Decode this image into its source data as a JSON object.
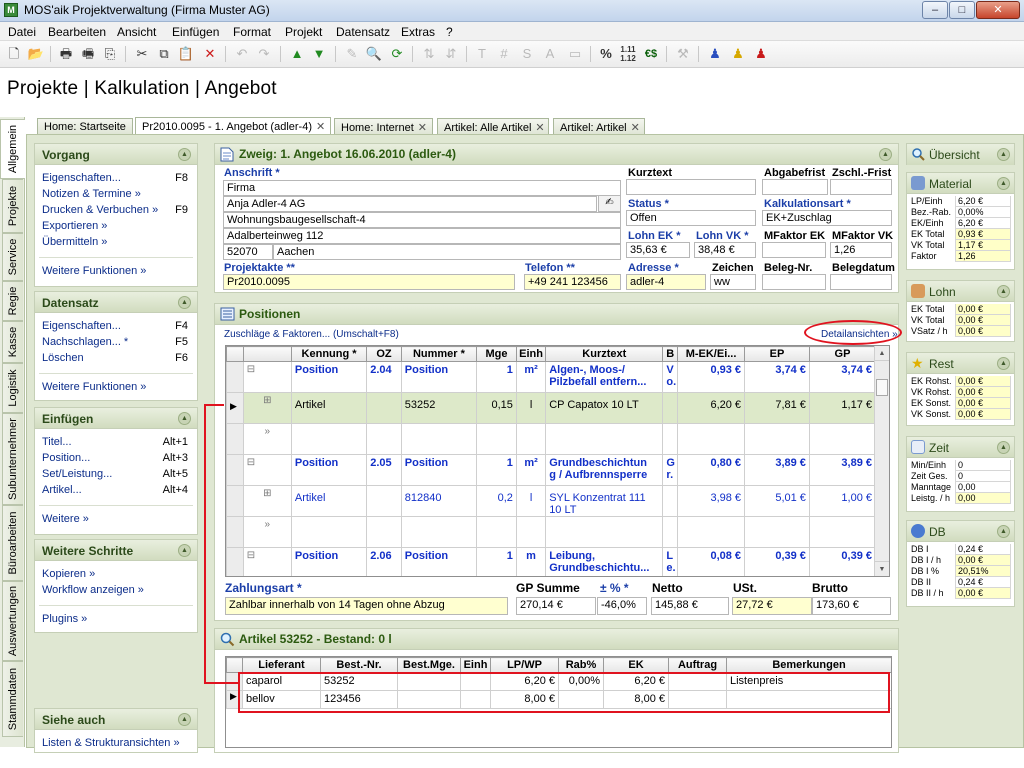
{
  "window": {
    "title": "MOS'aik Projektverwaltung (Firma Muster AG)",
    "minimize": "–",
    "maximize": "□",
    "close": "✕"
  },
  "menu": [
    "Datei",
    "Bearbeiten",
    "Ansicht",
    "Einfügen",
    "Format",
    "Projekt",
    "Datensatz",
    "Extras",
    "?"
  ],
  "toolbar": {
    "numbers_icon_text": "1.11 1.12",
    "euro_icon_text": "€$",
    "pct_icon_text": "%",
    "hash_icon_text": "#",
    "t_icon_text": "T",
    "s_icon_text": "S",
    "a_icon_text": "A"
  },
  "app_title": "Projekte | Kalkulation | Angebot",
  "side_tabs": [
    "Allgemein",
    "Projekte",
    "Service",
    "Regie",
    "Kasse",
    "Logistik",
    "Subunternehmer",
    "Büroarbeiten",
    "Auswertungen",
    "Stammdaten"
  ],
  "doc_tabs": [
    "Home: Startseite",
    "Pr2010.0095 - 1. Angebot (adler-4)",
    "Home: Internet",
    "Artikel: Alle Artikel",
    "Artikel: Artikel"
  ],
  "left_panels": {
    "vorgang": {
      "title": "Vorgang",
      "items": [
        {
          "label": "Eigenschaften...",
          "key": "F8"
        },
        {
          "label": "Notizen & Termine »",
          "key": ""
        },
        {
          "label": "Drucken & Verbuchen »",
          "key": "F9"
        },
        {
          "label": "Exportieren »",
          "key": ""
        },
        {
          "label": "Übermitteln »",
          "key": ""
        }
      ],
      "more": "Weitere Funktionen »"
    },
    "datensatz": {
      "title": "Datensatz",
      "items": [
        {
          "label": "Eigenschaften...",
          "key": "F4"
        },
        {
          "label": "Nachschlagen... *",
          "key": "F5"
        },
        {
          "label": "Löschen",
          "key": "F6"
        }
      ],
      "more": "Weitere Funktionen »"
    },
    "einfuegen": {
      "title": "Einfügen",
      "items": [
        {
          "label": "Titel...",
          "key": "Alt+1"
        },
        {
          "label": "Position...",
          "key": "Alt+3"
        },
        {
          "label": "Set/Leistung...",
          "key": "Alt+5"
        },
        {
          "label": "Artikel...",
          "key": "Alt+4"
        }
      ],
      "more": "Weitere »"
    },
    "weitere_schritte": {
      "title": "Weitere Schritte",
      "items": [
        {
          "label": "Kopieren »"
        },
        {
          "label": "Workflow anzeigen »"
        }
      ],
      "more": "Plugins »"
    },
    "siehe_auch": {
      "title": "Siehe auch",
      "items": [
        {
          "label": "Listen & Strukturansichten »"
        }
      ]
    }
  },
  "zweig": {
    "title": "Zweig: 1. Angebot 16.06.2010 (adler-4)",
    "anschrift_label": "Anschrift *",
    "address": {
      "line1": "Firma",
      "line2": "Anja Adler-4 AG",
      "line3": "Wohnungsbaugesellschaft-4",
      "line4": "Adalberteinweg 112",
      "plz": "52070",
      "city": "Aachen"
    },
    "kurztext_label": "Kurztext",
    "abgabefrist_label": "Abgabefrist",
    "zschl_frist_label": "Zschl.-Frist",
    "status_label": "Status *",
    "status_value": "Offen",
    "kalkulationsart_label": "Kalkulationsart *",
    "kalkulationsart_value": "EK+Zuschlag",
    "lohn_ek_label": "Lohn EK *",
    "lohn_ek_value": "35,63 €",
    "lohn_vk_label": "Lohn VK *",
    "lohn_vk_value": "38,48 €",
    "mfaktor_ek_label": "MFaktor EK",
    "mfaktor_vk_label": "MFaktor VK",
    "mfaktor_vk_value": "1,26",
    "projektakte_label": "Projektakte **",
    "projektakte_value": "Pr2010.0095",
    "telefon_label": "Telefon **",
    "telefon_value": "+49 241 123456",
    "adresse_label": "Adresse *",
    "adresse_value": "adler-4",
    "zeichen_label": "Zeichen",
    "zeichen_value": "ww",
    "beleg_nr_label": "Beleg-Nr.",
    "belegdatum_label": "Belegdatum"
  },
  "positionen": {
    "title": "Positionen",
    "zuschlaege_link": "Zuschläge & Faktoren... (Umschalt+F8)",
    "detail_link": "Detailansichten »",
    "columns": [
      "Kennung *",
      "OZ",
      "Nummer *",
      "Mge",
      "Einh",
      "Kurztext",
      "B",
      "M-EK/Ei...",
      "EP",
      "GP"
    ],
    "rows": [
      {
        "type": "pos",
        "kennung": "Position",
        "oz": "2.04",
        "nummer": "Position",
        "mge": "1",
        "einh": "m²",
        "kurztext": "Algen-, Moos-/",
        "kurztext2": "Pilzbefall entfern...",
        "b": "V",
        "b2": "o.",
        "mek": "0,93 €",
        "ep": "3,74 €",
        "gp": "3,74 €"
      },
      {
        "type": "sel",
        "kennung": "Artikel",
        "oz": "",
        "nummer": "53252",
        "mge": "0,15",
        "einh": "l",
        "kurztext": "CP Capatox 10 LT",
        "kurztext2": "",
        "b": "",
        "b2": "",
        "mek": "6,20 €",
        "ep": "7,81 €",
        "gp": "1,17 €"
      },
      {
        "type": "empty",
        "kennung": "",
        "oz": "",
        "nummer": "",
        "mge": "",
        "einh": "",
        "kurztext": "",
        "kurztext2": "",
        "b": "",
        "b2": "",
        "mek": "",
        "ep": "",
        "gp": ""
      },
      {
        "type": "pos",
        "kennung": "Position",
        "oz": "2.05",
        "nummer": "Position",
        "mge": "1",
        "einh": "m²",
        "kurztext": "Grundbeschichtun",
        "kurztext2": "g / Aufbrennsperre",
        "b": "G",
        "b2": "r.",
        "mek": "0,80 €",
        "ep": "3,89 €",
        "gp": "3,89 €"
      },
      {
        "type": "art",
        "kennung": "Artikel",
        "oz": "",
        "nummer": "812840",
        "mge": "0,2",
        "einh": "l",
        "kurztext": "SYL Konzentrat 111",
        "kurztext2": "10 LT",
        "b": "",
        "b2": "",
        "mek": "3,98 €",
        "ep": "5,01 €",
        "gp": "1,00 €"
      },
      {
        "type": "empty",
        "kennung": "",
        "oz": "",
        "nummer": "",
        "mge": "",
        "einh": "",
        "kurztext": "",
        "kurztext2": "",
        "b": "",
        "b2": "",
        "mek": "",
        "ep": "",
        "gp": ""
      },
      {
        "type": "pos",
        "kennung": "Position",
        "oz": "2.06",
        "nummer": "Position",
        "mge": "1",
        "einh": "m",
        "kurztext": "Leibung,",
        "kurztext2": "Grundbeschichtu...",
        "b": "L",
        "b2": "e.",
        "mek": "0,08 €",
        "ep": "0,39 €",
        "gp": "0,39 €"
      }
    ]
  },
  "summen": {
    "zahlungsart_label": "Zahlungsart *",
    "zahlungsart_value": "Zahlbar innerhalb von 14 Tagen ohne Abzug",
    "gp_summe_label": "GP Summe",
    "gp_summe_value": "270,14 €",
    "pct_label": "± % *",
    "pct_value": "-46,0%",
    "netto_label": "Netto",
    "netto_value": "145,88 €",
    "ust_label": "USt.",
    "ust_value": "27,72 €",
    "brutto_label": "Brutto",
    "brutto_value": "173,60 €"
  },
  "artikel": {
    "title": "Artikel 53252 - Bestand: 0 l",
    "columns": [
      "Lieferant",
      "Best.-Nr.",
      "Best.Mge.",
      "Einh",
      "LP/WP",
      "Rab%",
      "EK",
      "Auftrag",
      "Bemerkungen"
    ],
    "rows": [
      {
        "lieferant": "caparol",
        "bestnr": "53252",
        "bestmge": "",
        "einh": "",
        "lpwp": "6,20 €",
        "rab": "0,00%",
        "ek": "6,20 €",
        "auftrag": "",
        "bemerkungen": "Listenpreis"
      },
      {
        "lieferant": "bellov",
        "bestnr": "123456",
        "bestmge": "",
        "einh": "",
        "lpwp": "8,00 €",
        "rab": "",
        "ek": "8,00 €",
        "auftrag": "",
        "bemerkungen": ""
      }
    ]
  },
  "right_panels": {
    "uebersicht": "Übersicht",
    "material": {
      "title": "Material",
      "rows": [
        {
          "label": "LP/Einh",
          "value": "6,20 €",
          "hl": false
        },
        {
          "label": "Bez.-Rab.",
          "value": "0,00%",
          "hl": false
        },
        {
          "label": "EK/Einh",
          "value": "6,20 €",
          "hl": false
        },
        {
          "label": "EK Total",
          "value": "0,93 €",
          "hl": true
        },
        {
          "label": "VK Total",
          "value": "1,17 €",
          "hl": true
        },
        {
          "label": "Faktor",
          "value": "1,26",
          "hl": true
        }
      ]
    },
    "lohn": {
      "title": "Lohn",
      "rows": [
        {
          "label": "EK Total",
          "value": "0,00 €",
          "hl": true
        },
        {
          "label": "VK Total",
          "value": "0,00 €",
          "hl": true
        },
        {
          "label": "VSatz / h",
          "value": "0,00 €",
          "hl": true
        }
      ]
    },
    "rest": {
      "title": "Rest",
      "rows": [
        {
          "label": "EK Rohst.",
          "value": "0,00 €",
          "hl": true
        },
        {
          "label": "VK Rohst.",
          "value": "0,00 €",
          "hl": true
        },
        {
          "label": "EK Sonst.",
          "value": "0,00 €",
          "hl": true
        },
        {
          "label": "VK Sonst.",
          "value": "0,00 €",
          "hl": true
        }
      ]
    },
    "zeit": {
      "title": "Zeit",
      "rows": [
        {
          "label": "Min/Einh",
          "value": "0",
          "hl": false
        },
        {
          "label": "Zeit Ges.",
          "value": "0",
          "hl": false
        },
        {
          "label": "Manntage",
          "value": "0,00",
          "hl": false
        },
        {
          "label": "Leistg. / h",
          "value": "0,00",
          "hl": true
        }
      ]
    },
    "db": {
      "title": "DB",
      "rows": [
        {
          "label": "DB I",
          "value": "0,24 €",
          "hl": false
        },
        {
          "label": "DB I / h",
          "value": "0,00 €",
          "hl": true
        },
        {
          "label": "DB I %",
          "value": "20,51%",
          "hl": true
        },
        {
          "label": "DB II",
          "value": "0,24 €",
          "hl": false
        },
        {
          "label": "DB II / h",
          "value": "0,00 €",
          "hl": true
        }
      ]
    }
  },
  "colors": {
    "panel_header": "#d1dcbf",
    "link_blue": "#0c2d8a",
    "position_blue": "#1230c8",
    "highlight_yellow": "#ffffd0",
    "annotation_red": "#e0131f"
  }
}
